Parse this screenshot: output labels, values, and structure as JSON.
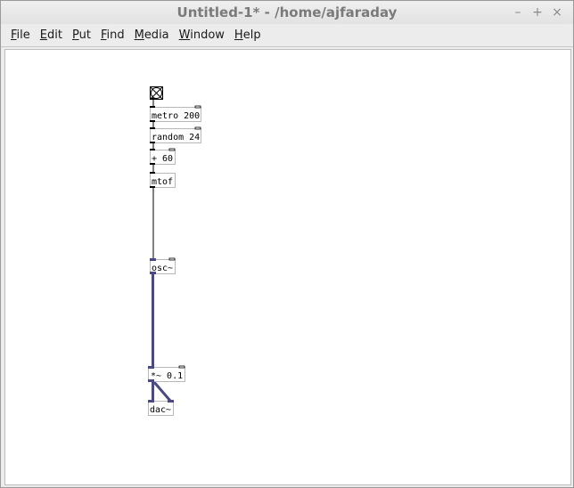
{
  "window": {
    "title": "Untitled-1* - /home/ajfaraday",
    "controls": [
      "–",
      "+",
      "×"
    ]
  },
  "menu": [
    {
      "label": "File",
      "ul": "F",
      "rest": "ile"
    },
    {
      "label": "Edit",
      "ul": "E",
      "rest": "dit"
    },
    {
      "label": "Put",
      "ul": "P",
      "rest": "ut"
    },
    {
      "label": "Find",
      "ul": "F",
      "rest": "ind"
    },
    {
      "label": "Media",
      "ul": "M",
      "rest": "edia"
    },
    {
      "label": "Window",
      "ul": "W",
      "rest": "indow"
    },
    {
      "label": "Help",
      "ul": "H",
      "rest": "elp"
    }
  ],
  "patch": {
    "objects": [
      {
        "id": "bang",
        "kind": "bng",
        "name": "bang-object"
      },
      {
        "id": "metro",
        "kind": "obj",
        "text": "metro 200",
        "name": "metro-object"
      },
      {
        "id": "random",
        "kind": "obj",
        "text": "random 24",
        "name": "random-object"
      },
      {
        "id": "plus",
        "kind": "obj",
        "text": "+ 60",
        "name": "plus-object"
      },
      {
        "id": "mtof",
        "kind": "obj",
        "text": "mtof",
        "name": "mtof-object"
      },
      {
        "id": "osc",
        "kind": "obj",
        "text": "osc~",
        "name": "osc-object"
      },
      {
        "id": "mul",
        "kind": "obj",
        "text": "*~ 0.1",
        "name": "multiply-object"
      },
      {
        "id": "dac",
        "kind": "obj",
        "text": "dac~",
        "name": "dac-object"
      }
    ],
    "connections": [
      {
        "from": "bang",
        "to": "metro",
        "signal": false
      },
      {
        "from": "metro",
        "to": "random",
        "signal": false
      },
      {
        "from": "random",
        "to": "plus",
        "signal": false
      },
      {
        "from": "plus",
        "to": "mtof",
        "signal": false
      },
      {
        "from": "mtof",
        "to": "osc",
        "signal": false
      },
      {
        "from": "osc",
        "to": "mul",
        "signal": true
      },
      {
        "from": "mul",
        "to": "dac-left",
        "signal": true
      },
      {
        "from": "mul",
        "to": "dac-right",
        "signal": true
      }
    ]
  }
}
